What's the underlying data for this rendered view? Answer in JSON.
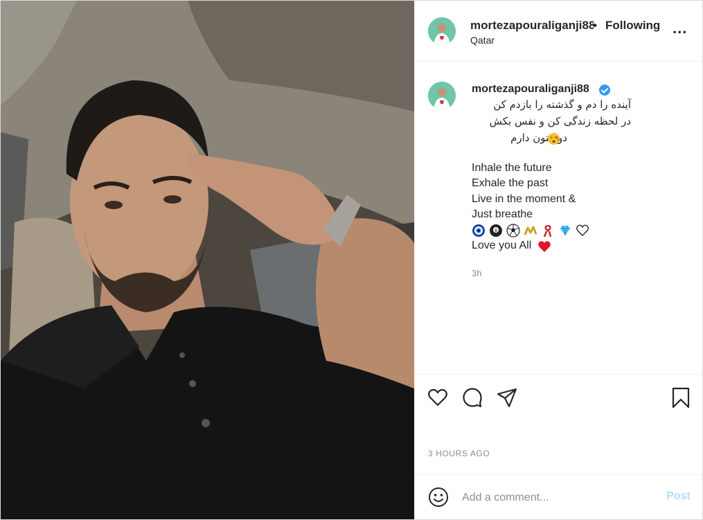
{
  "header": {
    "username": "mortezapouraliganji88",
    "separator": "•",
    "follow_label": "Following",
    "location": "Qatar",
    "more_label": "..."
  },
  "caption": {
    "username": "mortezapouraliganji88",
    "verified": true,
    "fa_lines": [
      "آینده را دم و گذشته را بازدم کن",
      "در لحظه زندگی کن و نفس بکش",
      "دوستون دارم"
    ],
    "en_lines": [
      "Inhale the future",
      "Exhale the past",
      "Live in the moment &",
      "Just breathe",
      "Love you All"
    ],
    "emojis": [
      "nazar-amulet-icon",
      "pool-8-ball-icon",
      "soccer-ball-icon",
      "chain-icon",
      "ribbon-icon",
      "gem-icon",
      "white-heart-icon"
    ],
    "relative_time": "3h"
  },
  "timestamp": "3 HOURS AGO",
  "comment": {
    "placeholder": "Add a comment...",
    "post_label": "Post"
  },
  "colors": {
    "link_blue": "#3897f0",
    "post_disabled": "#b2dffc",
    "muted_text": "#8e8e8e",
    "border": "#efefef"
  }
}
